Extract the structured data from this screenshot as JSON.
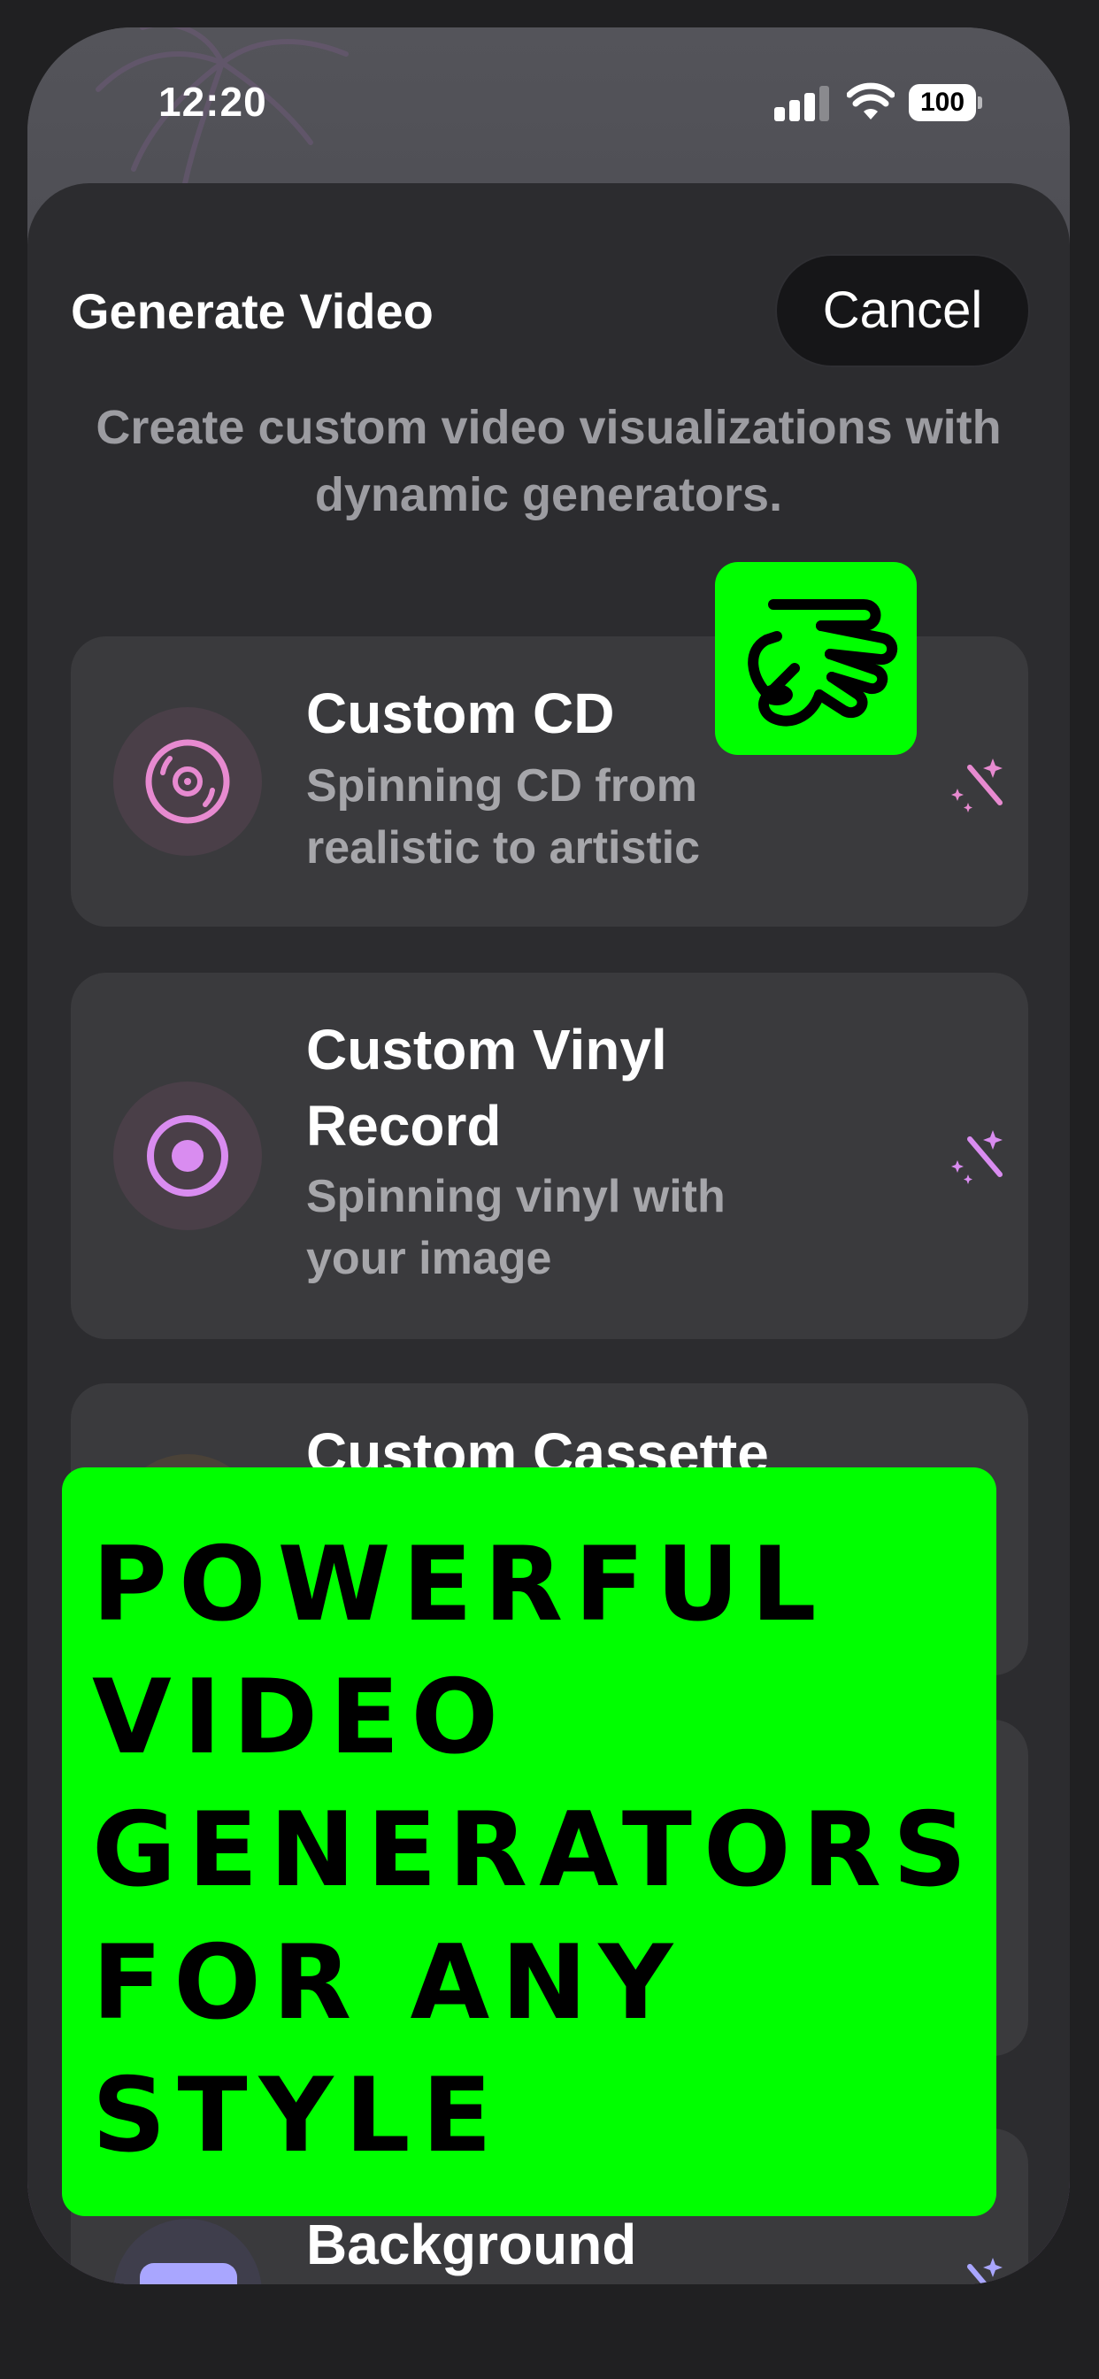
{
  "status_bar": {
    "time": "12:20",
    "battery": "100"
  },
  "header": {
    "title": "Generate Video",
    "cancel_label": "Cancel"
  },
  "subtitle": "Create custom video visualizations with dynamic generators.",
  "generators": [
    {
      "title": "Custom CD",
      "description": "Spinning CD from realistic to artistic",
      "icon": "cd-icon",
      "accent": "#e78ad0"
    },
    {
      "title": "Custom Vinyl Record",
      "description": "Spinning vinyl with your image",
      "icon": "vinyl-icon",
      "accent": "#d98cf0"
    },
    {
      "title": "Custom Cassette",
      "description": "",
      "icon": "cassette-icon",
      "accent": "#f0b060"
    },
    {
      "title": "Background",
      "description": "",
      "icon": "background-icon",
      "accent": "#a9a6ff"
    }
  ],
  "promo": {
    "text": "Powerful video generators for any style"
  },
  "colors": {
    "promo_green": "#00ff00",
    "sheet_bg": "#2c2c2f",
    "card_bg": "#3a3a3d"
  }
}
